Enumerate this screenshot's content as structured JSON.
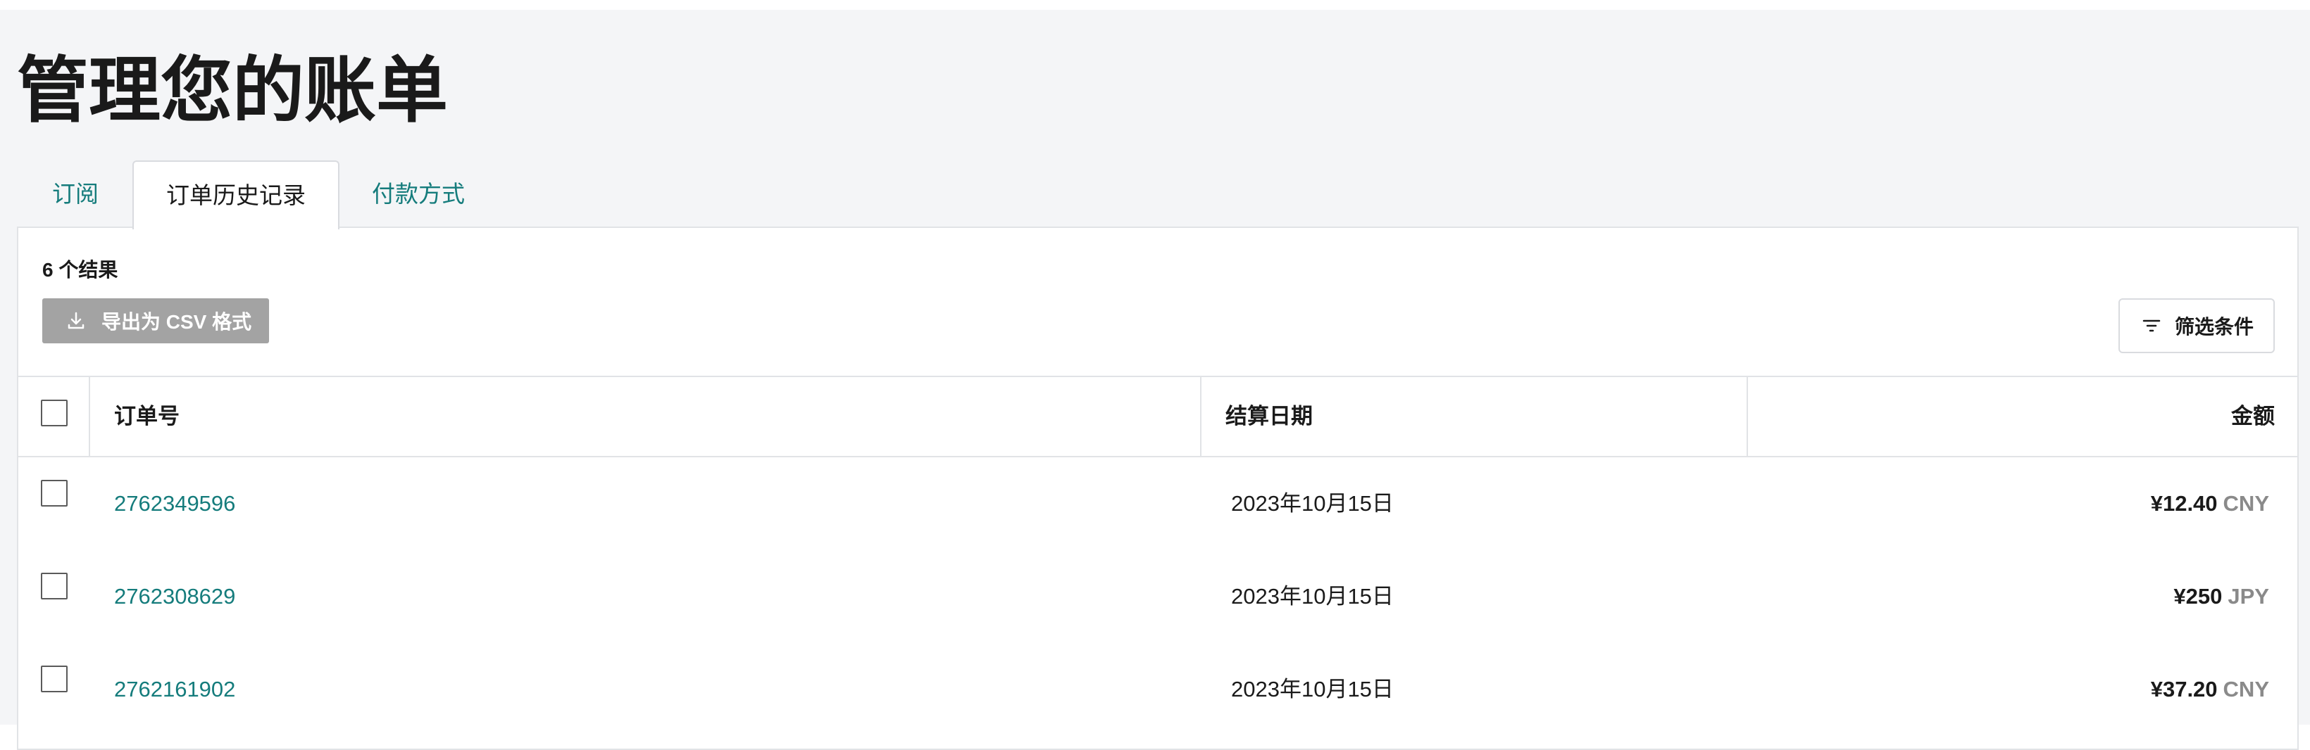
{
  "page": {
    "title": "管理您的账单"
  },
  "tabs": [
    {
      "label": "订阅",
      "active": false
    },
    {
      "label": "订单历史记录",
      "active": true
    },
    {
      "label": "付款方式",
      "active": false
    }
  ],
  "panel": {
    "results_count": "6 个结果",
    "export_label": "导出为 CSV 格式",
    "export_icon": "download-icon",
    "filter_label": "筛选条件",
    "filter_icon": "filter-icon"
  },
  "table": {
    "columns": [
      "订单号",
      "结算日期",
      "金额"
    ],
    "rows": [
      {
        "order": "2762349596",
        "date": "2023年10月15日",
        "amount": "¥12.40",
        "currency": "CNY"
      },
      {
        "order": "2762308629",
        "date": "2023年10月15日",
        "amount": "¥250",
        "currency": "JPY"
      },
      {
        "order": "2762161902",
        "date": "2023年10月15日",
        "amount": "¥37.20",
        "currency": "CNY"
      }
    ]
  },
  "colors": {
    "accent": "#157c7c",
    "page_bg": "#f4f5f7",
    "disabled_button": "#a3a3a3",
    "muted_text": "#8a8a8a"
  }
}
